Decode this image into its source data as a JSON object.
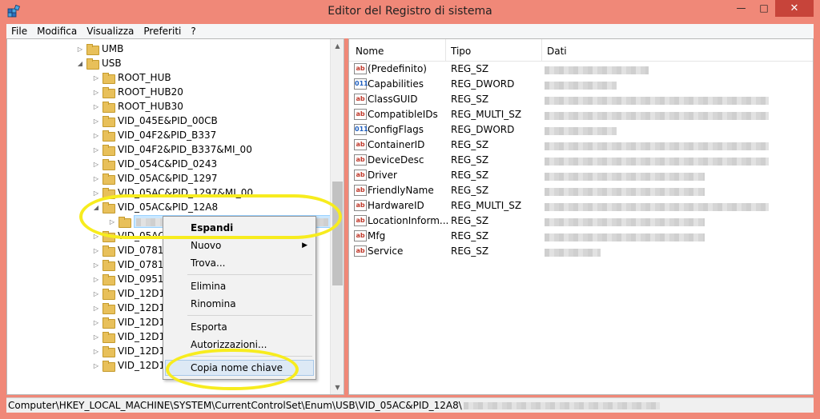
{
  "window": {
    "title": "Editor del Registro di sistema"
  },
  "menubar": {
    "items": [
      "File",
      "Modifica",
      "Visualizza",
      "Preferiti",
      "?"
    ]
  },
  "tree": {
    "items": [
      {
        "label": "UMB",
        "expanded": false
      },
      {
        "label": "USB",
        "expanded": true
      },
      {
        "label": "ROOT_HUB",
        "expanded": false
      },
      {
        "label": "ROOT_HUB20",
        "expanded": false
      },
      {
        "label": "ROOT_HUB30",
        "expanded": false
      },
      {
        "label": "VID_045E&PID_00CB",
        "expanded": false
      },
      {
        "label": "VID_04F2&PID_B337",
        "expanded": false
      },
      {
        "label": "VID_04F2&PID_B337&MI_00",
        "expanded": false
      },
      {
        "label": "VID_054C&PID_0243",
        "expanded": false
      },
      {
        "label": "VID_05AC&PID_1297",
        "expanded": false
      },
      {
        "label": "VID_05AC&PID_1297&MI_00",
        "expanded": false
      },
      {
        "label": "VID_05AC&PID_12A8",
        "expanded": true
      },
      {
        "label": "",
        "expanded": false
      },
      {
        "label": "VID_05AC",
        "expanded": false
      },
      {
        "label": "VID_0781&",
        "expanded": false
      },
      {
        "label": "VID_0781&",
        "expanded": false
      },
      {
        "label": "VID_0951&",
        "expanded": false
      },
      {
        "label": "VID_12D1",
        "expanded": false
      },
      {
        "label": "VID_12D1",
        "expanded": false
      },
      {
        "label": "VID_12D1",
        "expanded": false
      },
      {
        "label": "VID_12D1",
        "expanded": false
      },
      {
        "label": "VID_12D1",
        "expanded": false
      },
      {
        "label": "VID_12D1",
        "expanded": false
      }
    ]
  },
  "list": {
    "columns": {
      "name": "Nome",
      "type": "Tipo",
      "data": "Dati"
    },
    "rows": [
      {
        "name": "(Predefinito)",
        "type": "REG_SZ",
        "icon": "string-value-icon"
      },
      {
        "name": "Capabilities",
        "type": "REG_DWORD",
        "icon": "binary-value-icon"
      },
      {
        "name": "ClassGUID",
        "type": "REG_SZ",
        "icon": "string-value-icon"
      },
      {
        "name": "CompatibleIDs",
        "type": "REG_MULTI_SZ",
        "icon": "string-value-icon"
      },
      {
        "name": "ConfigFlags",
        "type": "REG_DWORD",
        "icon": "binary-value-icon"
      },
      {
        "name": "ContainerID",
        "type": "REG_SZ",
        "icon": "string-value-icon"
      },
      {
        "name": "DeviceDesc",
        "type": "REG_SZ",
        "icon": "string-value-icon"
      },
      {
        "name": "Driver",
        "type": "REG_SZ",
        "icon": "string-value-icon"
      },
      {
        "name": "FriendlyName",
        "type": "REG_SZ",
        "icon": "string-value-icon"
      },
      {
        "name": "HardwareID",
        "type": "REG_MULTI_SZ",
        "icon": "string-value-icon"
      },
      {
        "name": "LocationInform...",
        "type": "REG_SZ",
        "icon": "string-value-icon"
      },
      {
        "name": "Mfg",
        "type": "REG_SZ",
        "icon": "string-value-icon"
      },
      {
        "name": "Service",
        "type": "REG_SZ",
        "icon": "string-value-icon"
      }
    ]
  },
  "context_menu": {
    "items": [
      {
        "label": "Espandi",
        "bold": true
      },
      {
        "label": "Nuovo",
        "submenu": true
      },
      {
        "label": "Trova..."
      },
      {
        "label": "Elimina"
      },
      {
        "label": "Rinomina"
      },
      {
        "label": "Esporta"
      },
      {
        "label": "Autorizzazioni..."
      },
      {
        "label": "Copia nome chiave",
        "hover": true
      }
    ]
  },
  "statusbar": {
    "path": "Computer\\HKEY_LOCAL_MACHINE\\SYSTEM\\CurrentControlSet\\Enum\\USB\\VID_05AC&PID_12A8\\"
  },
  "colors": {
    "titlebar": "#f08878",
    "close_button": "#c7443a",
    "highlight_marker": "#f7ec1e",
    "selection": "#cce8ff"
  }
}
